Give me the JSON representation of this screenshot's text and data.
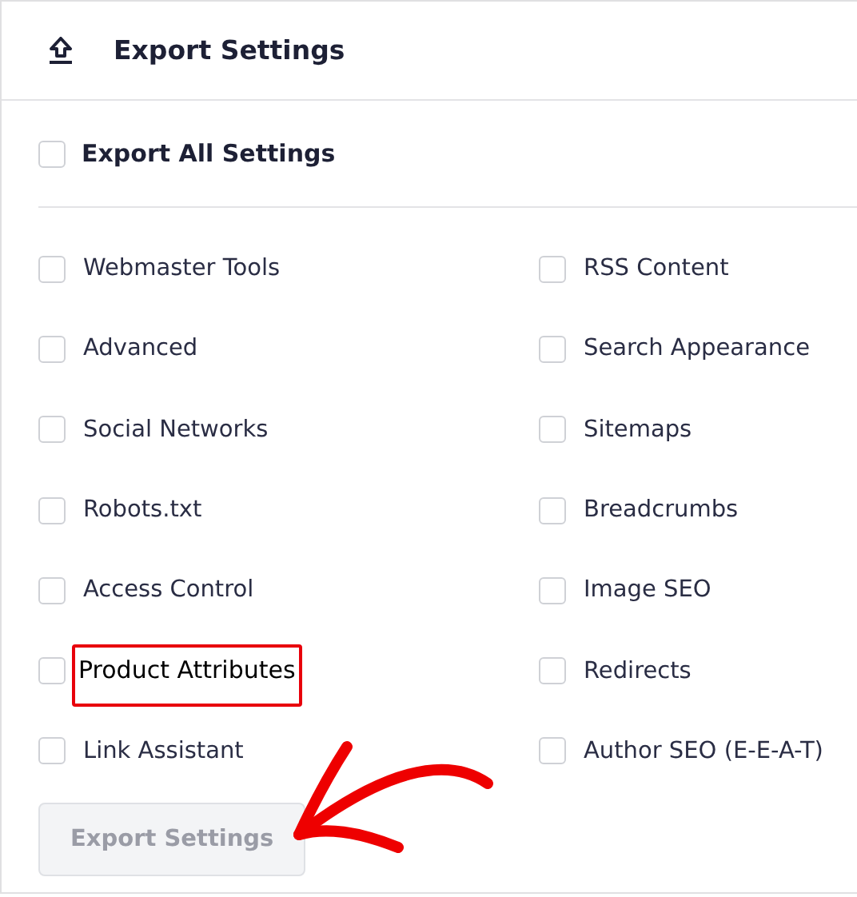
{
  "header": {
    "title": "Export Settings"
  },
  "export_all": {
    "label": "Export All Settings",
    "checked": false
  },
  "options": [
    {
      "label": "Webmaster Tools",
      "checked": false,
      "highlighted": false
    },
    {
      "label": "RSS Content",
      "checked": false,
      "highlighted": false
    },
    {
      "label": "Advanced",
      "checked": false,
      "highlighted": false
    },
    {
      "label": "Search Appearance",
      "checked": false,
      "highlighted": false
    },
    {
      "label": "Social Networks",
      "checked": false,
      "highlighted": false
    },
    {
      "label": "Sitemaps",
      "checked": false,
      "highlighted": false
    },
    {
      "label": "Robots.txt",
      "checked": false,
      "highlighted": false
    },
    {
      "label": "Breadcrumbs",
      "checked": false,
      "highlighted": false
    },
    {
      "label": "Access Control",
      "checked": false,
      "highlighted": false
    },
    {
      "label": "Image SEO",
      "checked": false,
      "highlighted": false
    },
    {
      "label": "Product Attributes",
      "checked": false,
      "highlighted": true
    },
    {
      "label": "Redirects",
      "checked": false,
      "highlighted": false
    },
    {
      "label": "Link Assistant",
      "checked": false,
      "highlighted": false
    },
    {
      "label": "Author SEO (E-E-A-T)",
      "checked": false,
      "highlighted": false
    }
  ],
  "button": {
    "label": "Export Settings",
    "disabled": true
  }
}
